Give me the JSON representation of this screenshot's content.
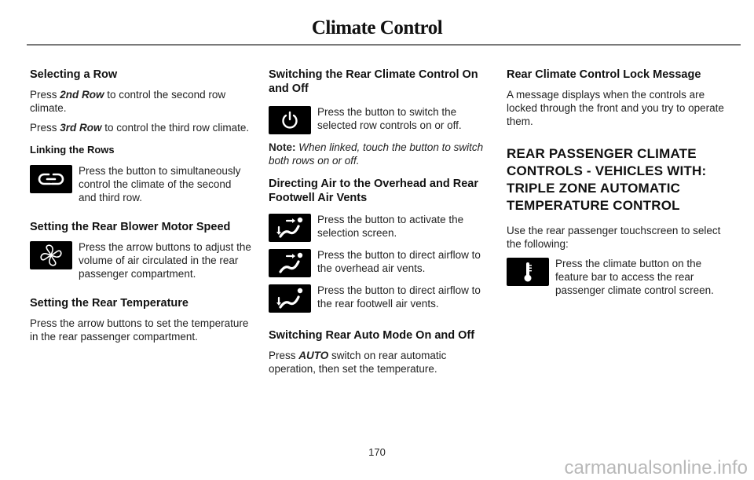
{
  "header": {
    "title": "Climate Control"
  },
  "col1": {
    "selecting_row": {
      "heading": "Selecting a Row",
      "p1": {
        "pre": "Press ",
        "emph": "2nd Row",
        "post": " to control the second row climate."
      },
      "p2": {
        "pre": "Press ",
        "emph": "3rd Row",
        "post": " to control the third row climate."
      }
    },
    "linking": {
      "heading": "Linking the Rows",
      "icon": "link-icon",
      "text": "Press the button to simultaneously control the climate of the second and third row."
    },
    "blower": {
      "heading": "Setting the Rear Blower Motor Speed",
      "icon": "fan-icon",
      "text": "Press the arrow buttons to adjust the volume of air circulated in the rear passenger compartment."
    },
    "temperature": {
      "heading": "Setting the Rear Temperature",
      "text": "Press the arrow buttons to set the temperature in the rear passenger compartment."
    }
  },
  "col2": {
    "onoff": {
      "heading": "Switching the Rear Climate Control On and Off",
      "icon": "power-icon",
      "text": "Press the button to switch the selected row controls on or off.",
      "note_label": "Note:",
      "note_text": " When linked, touch the button to switch both rows on or off."
    },
    "directing": {
      "heading": "Directing Air to the Overhead and Rear Footwell Air Vents",
      "items": [
        {
          "icon": "overhead-footwell-airflow-icon",
          "text": "Press the button to activate the selection screen."
        },
        {
          "icon": "overhead-airflow-icon",
          "text": "Press the button to direct airflow to the overhead air vents."
        },
        {
          "icon": "footwell-airflow-icon",
          "text": "Press the button to direct airflow to the rear footwell air vents."
        }
      ]
    },
    "auto": {
      "heading": "Switching Rear Auto Mode On and Off",
      "p": {
        "pre": "Press ",
        "emph": "AUTO",
        "post": " switch on rear automatic operation, then set the temperature."
      }
    }
  },
  "col3": {
    "lock": {
      "heading": "Rear Climate Control Lock Message",
      "text": "A message displays when the controls are locked through the front and you try to operate them."
    },
    "section": {
      "heading_lines": [
        "REAR PASSENGER CLIMATE",
        "CONTROLS - VEHICLES WITH:",
        "TRIPLE ZONE AUTOMATIC",
        "TEMPERATURE CONTROL"
      ],
      "intro": "Use the rear passenger touchscreen to select the following:",
      "icon": "thermometer-icon",
      "text": "Press the climate button on the feature bar to access the rear passenger climate control screen."
    }
  },
  "footer": {
    "page_number": "170",
    "watermark": "carmanualsonline.info"
  }
}
